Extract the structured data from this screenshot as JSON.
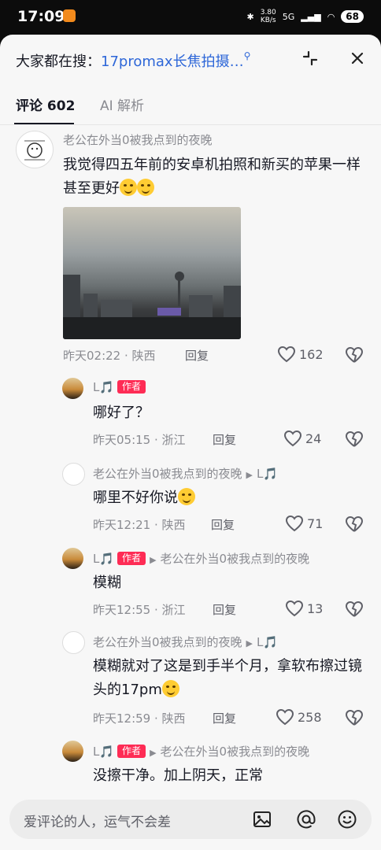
{
  "status_bar": {
    "time": "17:09",
    "speed_value": "3.80",
    "speed_unit": "KB/s",
    "network": "5G",
    "battery": "68"
  },
  "search_suggest": {
    "prefix": "大家都在搜：",
    "query": "17promax长焦拍摄…"
  },
  "tabs": [
    {
      "label": "评论 602",
      "active": true
    },
    {
      "label": "AI 解析",
      "active": false
    }
  ],
  "comments": [
    {
      "user": "老公在外当0被我点到的夜晚",
      "text": "我觉得四五年前的安卓机拍照和新买的苹果一样甚至更好",
      "time": "昨天02:22 · 陕西",
      "reply": "回复",
      "likes": "162"
    },
    {
      "user": "L🎵",
      "tag": "作者",
      "text": "哪好了？",
      "time": "昨天05:15 · 浙江",
      "reply": "回复",
      "likes": "24"
    },
    {
      "user": "老公在外当0被我点到的夜晚",
      "to": "L🎵",
      "text": "哪里不好你说",
      "time": "昨天12:21 · 陕西",
      "reply": "回复",
      "likes": "71"
    },
    {
      "user": "L🎵",
      "tag": "作者",
      "to": "老公在外当0被我点到的夜晚",
      "text": "模糊",
      "time": "昨天12:55 · 浙江",
      "reply": "回复",
      "likes": "13"
    },
    {
      "user": "老公在外当0被我点到的夜晚",
      "to": "L🎵",
      "text": "模糊就对了这是到手半个月，拿软布擦过镜头的17pm",
      "time": "昨天12:59 · 陕西",
      "reply": "回复",
      "likes": "258"
    },
    {
      "user": "L🎵",
      "tag": "作者",
      "to": "老公在外当0被我点到的夜晚",
      "text": "没擦干净。加上阴天，正常"
    }
  ],
  "input": {
    "placeholder": "爱评论的人，运气不会差"
  },
  "colors": {
    "accent_red": "#fe2c55",
    "link_blue": "#2e67d8"
  }
}
